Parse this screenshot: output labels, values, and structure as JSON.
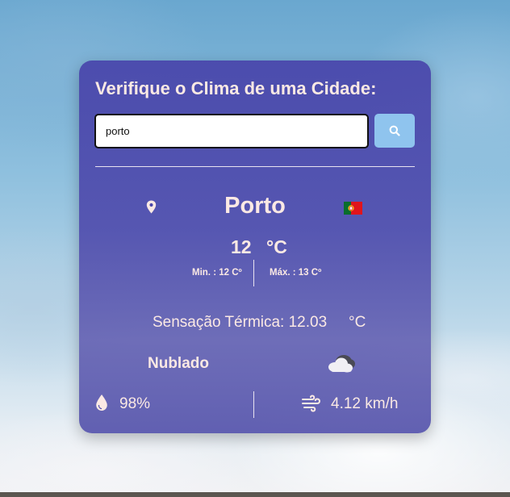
{
  "card": {
    "title": "Verifique o Clima de uma Cidade:"
  },
  "search": {
    "value": "porto",
    "icon": "search-icon"
  },
  "weather": {
    "city": "Porto",
    "country_flag": "flag-portugal-icon",
    "temperature": "12",
    "temperature_unit": "°C",
    "min": "Min. : 12 Cº",
    "max": "Máx. : 13 Cº",
    "feels_like": "Sensação Térmica: 12.03",
    "feels_like_unit": "°C",
    "description": "Nublado",
    "description_icon": "cloud-icon",
    "humidity": "98%",
    "humidity_icon": "droplet-icon",
    "wind": "4.12 km/h",
    "wind_icon": "wind-icon"
  },
  "colors": {
    "card_bg": "#4a46aa",
    "text": "#fbe9e4",
    "search_button": "#8fc4ee"
  }
}
